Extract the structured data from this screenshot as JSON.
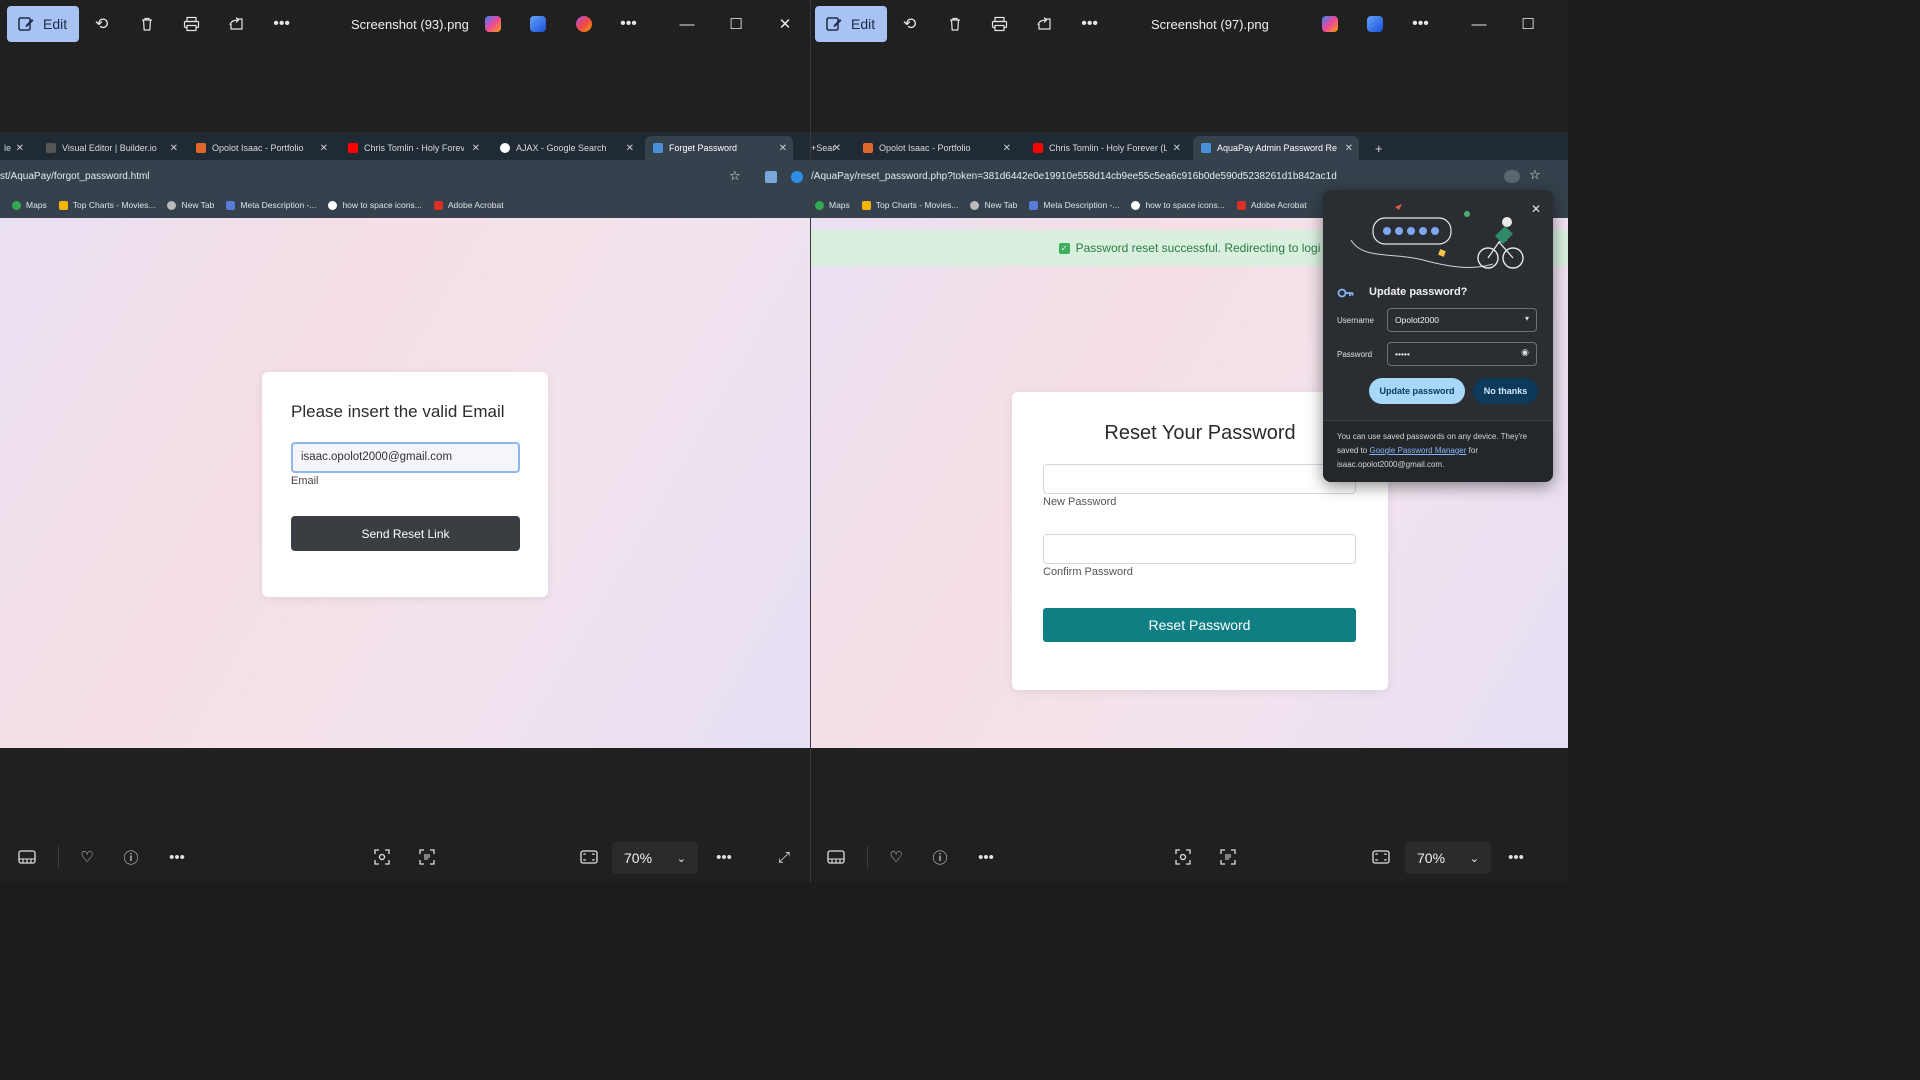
{
  "left_window": {
    "edit_label": "Edit",
    "title": "Screenshot (93).png",
    "zoom": "70%",
    "browser": {
      "tabs": [
        {
          "label": "le"
        },
        {
          "label": "Visual Editor | Builder.io"
        },
        {
          "label": "Opolot Isaac - Portfolio"
        },
        {
          "label": "Chris Tomlin - Holy Forever"
        },
        {
          "label": "AJAX - Google Search"
        },
        {
          "label": "Forget Password",
          "active": true
        }
      ],
      "url": "st/AquaPay/forgot_password.html",
      "bookmarks": [
        "Maps",
        "Top Charts - Movies...",
        "New Tab",
        "Meta Description -...",
        "how to space icons...",
        "Adobe Acrobat"
      ],
      "page": {
        "heading": "Please insert the valid Email",
        "email_value": "isaac.opolot2000@gmail.com",
        "email_label": "Email",
        "send_button": "Send Reset Link"
      }
    }
  },
  "right_window": {
    "edit_label": "Edit",
    "title": "Screenshot (97).png",
    "zoom": "70%",
    "browser": {
      "tabs": [
        {
          "label": "+Sear"
        },
        {
          "label": "Opolot Isaac - Portfolio"
        },
        {
          "label": "Chris Tomlin - Holy Forever (Liv"
        },
        {
          "label": "AquaPay Admin Password Rese",
          "active": true
        }
      ],
      "new_tab": "+",
      "url": "/AquaPay/reset_password.php?token=381d6442e0e19910e558d14cb9ee55c5ea6c916b0de590d5238261d1b842ac1d",
      "bookmarks": [
        "Maps",
        "Top Charts - Movies...",
        "New Tab",
        "Meta Description -...",
        "how to space icons...",
        "Adobe Acrobat"
      ],
      "page": {
        "success_message": "Password reset successful. Redirecting to logi",
        "heading": "Reset Your Password",
        "new_password_label": "New Password",
        "confirm_password_label": "Confirm Password",
        "reset_button": "Reset Password"
      },
      "password_popup": {
        "title": "Update password?",
        "username_label": "Username",
        "username_value": "Opolot2000",
        "password_label": "Password",
        "password_value": "•••••",
        "update_button": "Update password",
        "no_thanks_button": "No thanks",
        "footer_text_1": "You can use saved passwords on any device. They're saved to ",
        "footer_link": "Google Password Manager",
        "footer_text_2": " for isaac.opolot2000@gmail.com."
      }
    }
  },
  "colors": {
    "edit_button": "#a8c3f3",
    "send_button": "#3a3d42",
    "reset_button": "#0f7f84",
    "success_bg": "#d9f0df",
    "popup_primary": "#a8d8f8"
  }
}
